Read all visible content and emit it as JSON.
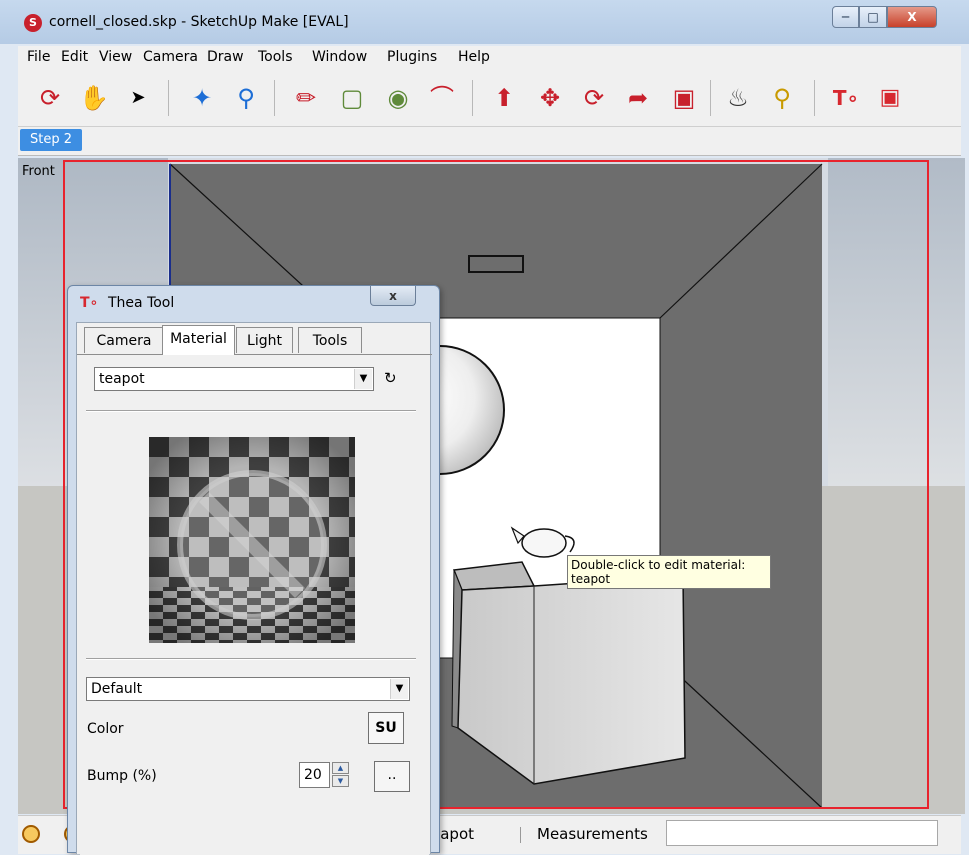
{
  "window": {
    "title": "cornell_closed.skp - SketchUp Make [EVAL]",
    "app_icon": "sketchup-icon",
    "controls": {
      "minimize": "minimize-icon",
      "maximize": "maximize-icon",
      "close": "close-icon"
    }
  },
  "menu": [
    "File",
    "Edit",
    "View",
    "Camera",
    "Draw",
    "Tools",
    "Window",
    "Plugins",
    "Help"
  ],
  "toolbar": {
    "tools": [
      "orbit",
      "pan",
      "select",
      "zoom-extents",
      "zoom",
      "pencil",
      "rectangle",
      "circle",
      "arc",
      "push-pull",
      "move",
      "rotate",
      "follow-me",
      "offset",
      "paint-bucket",
      "tape-measure",
      "thea-render",
      "thea-camera"
    ]
  },
  "scenes": {
    "active_tab": "Step 2"
  },
  "viewport": {
    "view_label": "Front",
    "tooltip_line1": "Double-click to edit material:",
    "tooltip_line2": "teapot",
    "colors": {
      "box_walls": "#6d6d6d",
      "back_wall": "#ffffff",
      "selection": "#e8232d"
    }
  },
  "statusbar": {
    "hint_text": "eapot",
    "measurements_label": "Measurements",
    "measurements_value": ""
  },
  "thea_tool": {
    "title": "Thea Tool",
    "close_label": "x",
    "tabs": [
      "Camera",
      "Material",
      "Light",
      "Tools"
    ],
    "active_tab": "Material",
    "material_name": "teapot",
    "preset": "Default",
    "color_label": "Color",
    "color_button": "SU",
    "bump_label": "Bump (%)",
    "bump_value": "20",
    "browse_button": ".."
  }
}
